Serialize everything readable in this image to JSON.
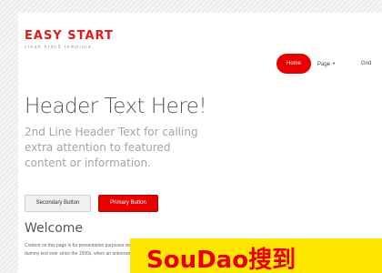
{
  "site": {
    "logo": "EASY START",
    "tagline": "clean html5 template"
  },
  "nav": {
    "items": [
      "Home",
      "Page",
      "Grid"
    ],
    "active_color": "#e60000"
  },
  "hero": {
    "title": "Header Text Here!",
    "subtitle": "2nd Line Header Text for calling extra attention to featured content or information.",
    "secondary_button": "Secondary Button",
    "primary_button": "Primary Button"
  },
  "welcome": {
    "heading": "Welcome",
    "text": "Content on this page is for presentation purposes only. Lorem Ipsum is simply dummy text of the printing and typesetting industry. Lorem Ipsum has been the industry's standard dummy text ever since the 1500s, when an unknown printer took a galley of type and scrambled it. Lorem ipsum dolor sit amet, consectetur adipiscing elit."
  },
  "watermark": {
    "text": "SouDao搜到"
  },
  "colors": {
    "brand": "#e01b1b",
    "primary_button": "#e60000",
    "watermark_bg": "#ffe600"
  }
}
